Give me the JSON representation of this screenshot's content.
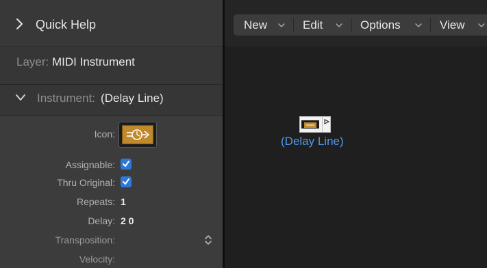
{
  "inspector": {
    "quick_help": {
      "title": "Quick Help"
    },
    "layer": {
      "label": "Layer:",
      "value": "MIDI Instrument"
    },
    "instrument": {
      "label": "Instrument:",
      "value": "(Delay Line)"
    },
    "params": {
      "icon": {
        "label": "Icon:",
        "icon_name": "delay-line-icon"
      },
      "assignable": {
        "label": "Assignable:",
        "checked": true
      },
      "thru_original": {
        "label": "Thru Original:",
        "checked": true
      },
      "repeats": {
        "label": "Repeats:",
        "value": "1"
      },
      "delay": {
        "label": "Delay:",
        "value": "2 0"
      },
      "transposition": {
        "label": "Transposition:",
        "value": ""
      },
      "velocity": {
        "label": "Velocity:",
        "value": ""
      }
    }
  },
  "environment": {
    "menus": [
      {
        "label": "New"
      },
      {
        "label": "Edit"
      },
      {
        "label": "Options"
      },
      {
        "label": "View"
      }
    ],
    "object": {
      "label": "(Delay Line)"
    }
  },
  "colors": {
    "accent_blue": "#2e78d8",
    "object_label": "#4f9aee",
    "icon_orange": "#c0892b"
  }
}
